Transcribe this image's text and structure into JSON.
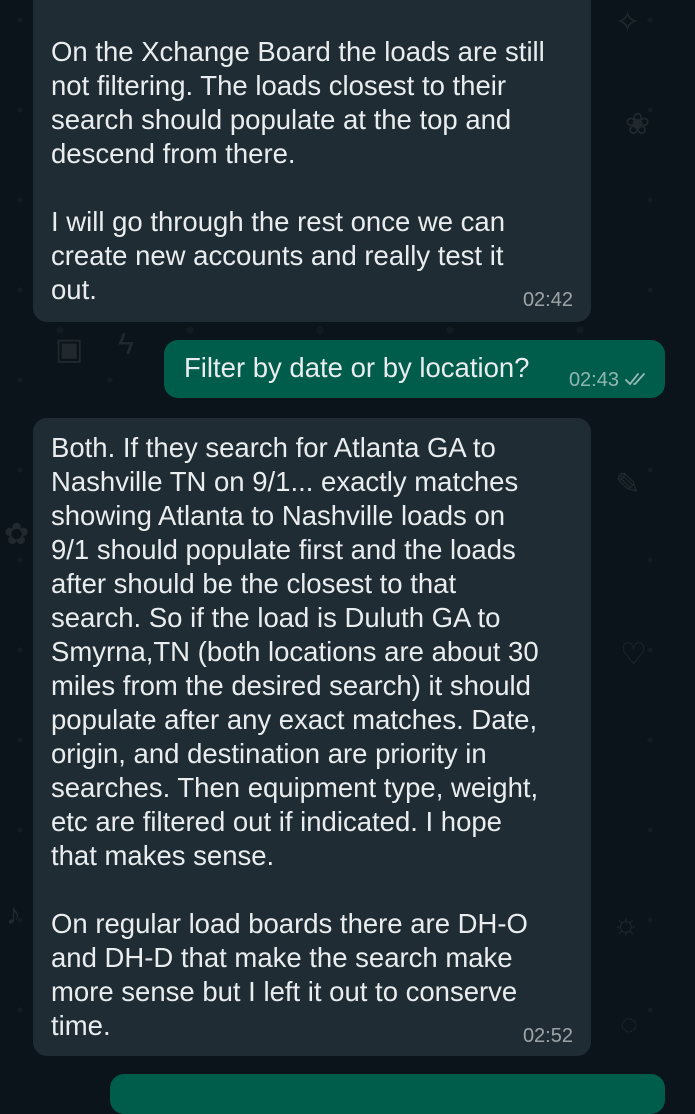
{
  "chat": {
    "messages": [
      {
        "direction": "incoming",
        "text": "On the Xchange Board the loads are still\nnot filtering. The loads closest to their\nsearch should populate at the top and\ndescend from there.\n\nI will go through the rest once we can\ncreate new accounts and really test it\nout.",
        "time": "02:42"
      },
      {
        "direction": "outgoing",
        "text": "Filter by date or by location?",
        "time": "02:43",
        "status_icon": "double-check-icon"
      },
      {
        "direction": "incoming",
        "text": "Both. If they search for Atlanta GA to\nNashville TN on 9/1... exactly matches\nshowing Atlanta to Nashville loads on\n9/1 should populate first and the loads\nafter should be the closest to that\nsearch. So if the load is Duluth GA to\nSmyrna,TN (both locations are about 30\nmiles from the desired search) it should\npopulate after any exact matches. Date,\norigin, and destination are priority in\nsearches. Then equipment type, weight,\netc are filtered out if indicated. I hope\nthat makes sense.\n\nOn regular load boards there are DH-O\nand DH-D that make the search make\nmore sense but I left it out to conserve\ntime.",
        "time": "02:52"
      }
    ]
  },
  "colors": {
    "background": "#0b141a",
    "incoming_bubble": "#202c33",
    "outgoing_bubble": "#005c4b",
    "text": "#e9edef"
  }
}
